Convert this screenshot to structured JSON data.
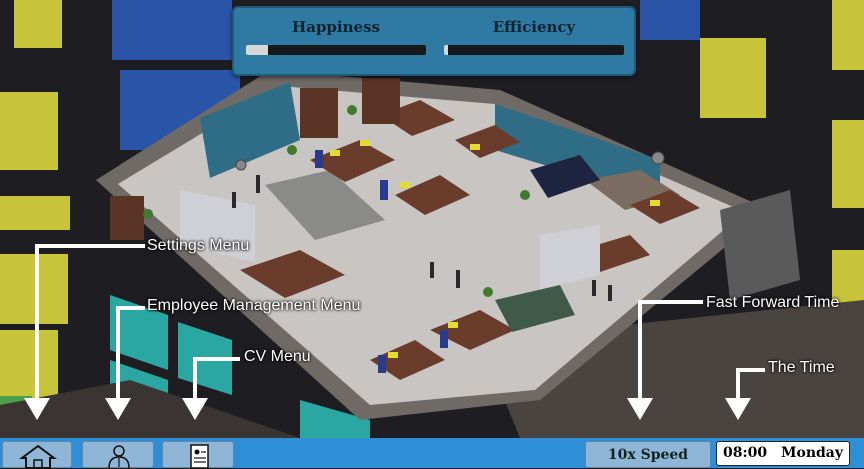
{
  "hud": {
    "happiness_label": "Happiness",
    "efficiency_label": "Efficiency",
    "happiness_level": 0.12,
    "efficiency_level": 0.02
  },
  "annotations": {
    "settings": "Settings Menu",
    "employee": "Employee Management Menu",
    "cv": "CV Menu",
    "fast_forward": "Fast Forward Time",
    "time": "The Time"
  },
  "toolbar": {
    "settings_icon": "house-icon",
    "employee_icon": "person-icon",
    "cv_icon": "document-icon",
    "speed_label": "10x Speed",
    "clock": "08:00",
    "day": "Monday"
  },
  "colors": {
    "hud_panel": "#2f7aa2",
    "toolbar": "#2f8fd6",
    "button": "#8fb6d6",
    "office_floor": "#c9c5c2",
    "window_yellow": "#c7c43a",
    "window_teal": "#2aa7a3",
    "sky_blue": "#2a54a8"
  }
}
